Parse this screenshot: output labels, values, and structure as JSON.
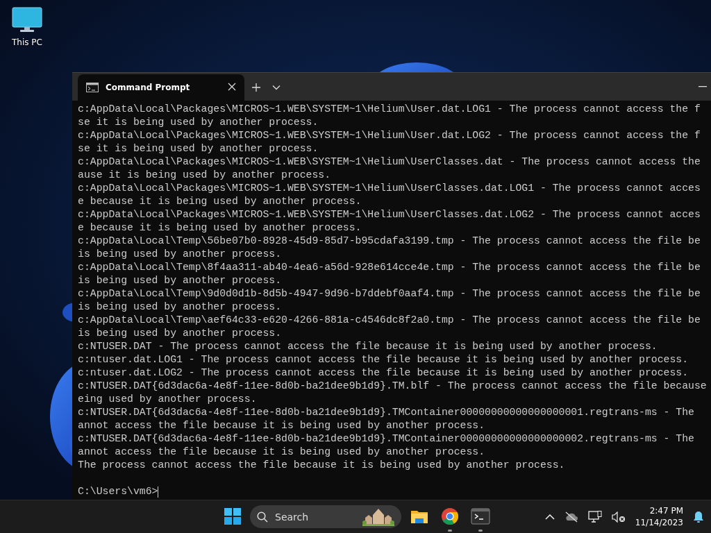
{
  "desktop_icons": [
    {
      "label": "This PC"
    }
  ],
  "window": {
    "tabs": [
      {
        "title": "Command Prompt",
        "selected": true
      }
    ],
    "lines": [
      "c:AppData\\Local\\Packages\\MICROS~1.WEB\\SYSTEM~1\\Helium\\User.dat.LOG1 - The process cannot access the f",
      "se it is being used by another process.",
      "c:AppData\\Local\\Packages\\MICROS~1.WEB\\SYSTEM~1\\Helium\\User.dat.LOG2 - The process cannot access the f",
      "se it is being used by another process.",
      "c:AppData\\Local\\Packages\\MICROS~1.WEB\\SYSTEM~1\\Helium\\UserClasses.dat - The process cannot access the",
      "ause it is being used by another process.",
      "c:AppData\\Local\\Packages\\MICROS~1.WEB\\SYSTEM~1\\Helium\\UserClasses.dat.LOG1 - The process cannot acces",
      "e because it is being used by another process.",
      "c:AppData\\Local\\Packages\\MICROS~1.WEB\\SYSTEM~1\\Helium\\UserClasses.dat.LOG2 - The process cannot acces",
      "e because it is being used by another process.",
      "c:AppData\\Local\\Temp\\56be07b0-8928-45d9-85d7-b95cdafa3199.tmp - The process cannot access the file be",
      "is being used by another process.",
      "c:AppData\\Local\\Temp\\8f4aa311-ab40-4ea6-a56d-928e614cce4e.tmp - The process cannot access the file be",
      "is being used by another process.",
      "c:AppData\\Local\\Temp\\9d0d0d1b-8d5b-4947-9d96-b7ddebf0aaf4.tmp - The process cannot access the file be",
      "is being used by another process.",
      "c:AppData\\Local\\Temp\\aef64c33-e620-4266-881a-c4546dc8f2a0.tmp - The process cannot access the file be",
      "is being used by another process.",
      "c:NTUSER.DAT - The process cannot access the file because it is being used by another process.",
      "c:ntuser.dat.LOG1 - The process cannot access the file because it is being used by another process.",
      "c:ntuser.dat.LOG2 - The process cannot access the file because it is being used by another process.",
      "c:NTUSER.DAT{6d3dac6a-4e8f-11ee-8d0b-ba21dee9b1d9}.TM.blf - The process cannot access the file because",
      "eing used by another process.",
      "c:NTUSER.DAT{6d3dac6a-4e8f-11ee-8d0b-ba21dee9b1d9}.TMContainer00000000000000000001.regtrans-ms - The",
      "annot access the file because it is being used by another process.",
      "c:NTUSER.DAT{6d3dac6a-4e8f-11ee-8d0b-ba21dee9b1d9}.TMContainer00000000000000000002.regtrans-ms - The",
      "annot access the file because it is being used by another process.",
      "The process cannot access the file because it is being used by another process."
    ],
    "prompt": "C:\\Users\\vm6>"
  },
  "taskbar": {
    "search": {
      "placeholder": "Search"
    },
    "apps": [
      {
        "kind": "folder",
        "running": false
      },
      {
        "kind": "browser",
        "running": true
      },
      {
        "kind": "terminal",
        "running": true
      }
    ],
    "clock": {
      "time": "2:47 PM",
      "date": "11/14/2023"
    }
  }
}
